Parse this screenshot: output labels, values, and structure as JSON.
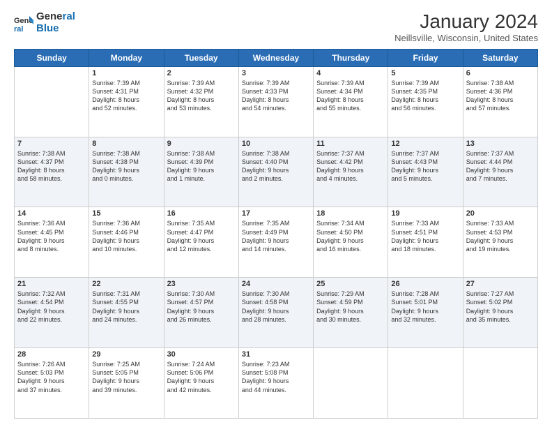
{
  "header": {
    "logo_line1": "General",
    "logo_line2": "Blue",
    "title": "January 2024",
    "subtitle": "Neillsville, Wisconsin, United States"
  },
  "weekdays": [
    "Sunday",
    "Monday",
    "Tuesday",
    "Wednesday",
    "Thursday",
    "Friday",
    "Saturday"
  ],
  "weeks": [
    [
      {
        "day": "",
        "info": ""
      },
      {
        "day": "1",
        "info": "Sunrise: 7:39 AM\nSunset: 4:31 PM\nDaylight: 8 hours\nand 52 minutes."
      },
      {
        "day": "2",
        "info": "Sunrise: 7:39 AM\nSunset: 4:32 PM\nDaylight: 8 hours\nand 53 minutes."
      },
      {
        "day": "3",
        "info": "Sunrise: 7:39 AM\nSunset: 4:33 PM\nDaylight: 8 hours\nand 54 minutes."
      },
      {
        "day": "4",
        "info": "Sunrise: 7:39 AM\nSunset: 4:34 PM\nDaylight: 8 hours\nand 55 minutes."
      },
      {
        "day": "5",
        "info": "Sunrise: 7:39 AM\nSunset: 4:35 PM\nDaylight: 8 hours\nand 56 minutes."
      },
      {
        "day": "6",
        "info": "Sunrise: 7:38 AM\nSunset: 4:36 PM\nDaylight: 8 hours\nand 57 minutes."
      }
    ],
    [
      {
        "day": "7",
        "info": "Sunrise: 7:38 AM\nSunset: 4:37 PM\nDaylight: 8 hours\nand 58 minutes."
      },
      {
        "day": "8",
        "info": "Sunrise: 7:38 AM\nSunset: 4:38 PM\nDaylight: 9 hours\nand 0 minutes."
      },
      {
        "day": "9",
        "info": "Sunrise: 7:38 AM\nSunset: 4:39 PM\nDaylight: 9 hours\nand 1 minute."
      },
      {
        "day": "10",
        "info": "Sunrise: 7:38 AM\nSunset: 4:40 PM\nDaylight: 9 hours\nand 2 minutes."
      },
      {
        "day": "11",
        "info": "Sunrise: 7:37 AM\nSunset: 4:42 PM\nDaylight: 9 hours\nand 4 minutes."
      },
      {
        "day": "12",
        "info": "Sunrise: 7:37 AM\nSunset: 4:43 PM\nDaylight: 9 hours\nand 5 minutes."
      },
      {
        "day": "13",
        "info": "Sunrise: 7:37 AM\nSunset: 4:44 PM\nDaylight: 9 hours\nand 7 minutes."
      }
    ],
    [
      {
        "day": "14",
        "info": "Sunrise: 7:36 AM\nSunset: 4:45 PM\nDaylight: 9 hours\nand 8 minutes."
      },
      {
        "day": "15",
        "info": "Sunrise: 7:36 AM\nSunset: 4:46 PM\nDaylight: 9 hours\nand 10 minutes."
      },
      {
        "day": "16",
        "info": "Sunrise: 7:35 AM\nSunset: 4:47 PM\nDaylight: 9 hours\nand 12 minutes."
      },
      {
        "day": "17",
        "info": "Sunrise: 7:35 AM\nSunset: 4:49 PM\nDaylight: 9 hours\nand 14 minutes."
      },
      {
        "day": "18",
        "info": "Sunrise: 7:34 AM\nSunset: 4:50 PM\nDaylight: 9 hours\nand 16 minutes."
      },
      {
        "day": "19",
        "info": "Sunrise: 7:33 AM\nSunset: 4:51 PM\nDaylight: 9 hours\nand 18 minutes."
      },
      {
        "day": "20",
        "info": "Sunrise: 7:33 AM\nSunset: 4:53 PM\nDaylight: 9 hours\nand 19 minutes."
      }
    ],
    [
      {
        "day": "21",
        "info": "Sunrise: 7:32 AM\nSunset: 4:54 PM\nDaylight: 9 hours\nand 22 minutes."
      },
      {
        "day": "22",
        "info": "Sunrise: 7:31 AM\nSunset: 4:55 PM\nDaylight: 9 hours\nand 24 minutes."
      },
      {
        "day": "23",
        "info": "Sunrise: 7:30 AM\nSunset: 4:57 PM\nDaylight: 9 hours\nand 26 minutes."
      },
      {
        "day": "24",
        "info": "Sunrise: 7:30 AM\nSunset: 4:58 PM\nDaylight: 9 hours\nand 28 minutes."
      },
      {
        "day": "25",
        "info": "Sunrise: 7:29 AM\nSunset: 4:59 PM\nDaylight: 9 hours\nand 30 minutes."
      },
      {
        "day": "26",
        "info": "Sunrise: 7:28 AM\nSunset: 5:01 PM\nDaylight: 9 hours\nand 32 minutes."
      },
      {
        "day": "27",
        "info": "Sunrise: 7:27 AM\nSunset: 5:02 PM\nDaylight: 9 hours\nand 35 minutes."
      }
    ],
    [
      {
        "day": "28",
        "info": "Sunrise: 7:26 AM\nSunset: 5:03 PM\nDaylight: 9 hours\nand 37 minutes."
      },
      {
        "day": "29",
        "info": "Sunrise: 7:25 AM\nSunset: 5:05 PM\nDaylight: 9 hours\nand 39 minutes."
      },
      {
        "day": "30",
        "info": "Sunrise: 7:24 AM\nSunset: 5:06 PM\nDaylight: 9 hours\nand 42 minutes."
      },
      {
        "day": "31",
        "info": "Sunrise: 7:23 AM\nSunset: 5:08 PM\nDaylight: 9 hours\nand 44 minutes."
      },
      {
        "day": "",
        "info": ""
      },
      {
        "day": "",
        "info": ""
      },
      {
        "day": "",
        "info": ""
      }
    ]
  ]
}
